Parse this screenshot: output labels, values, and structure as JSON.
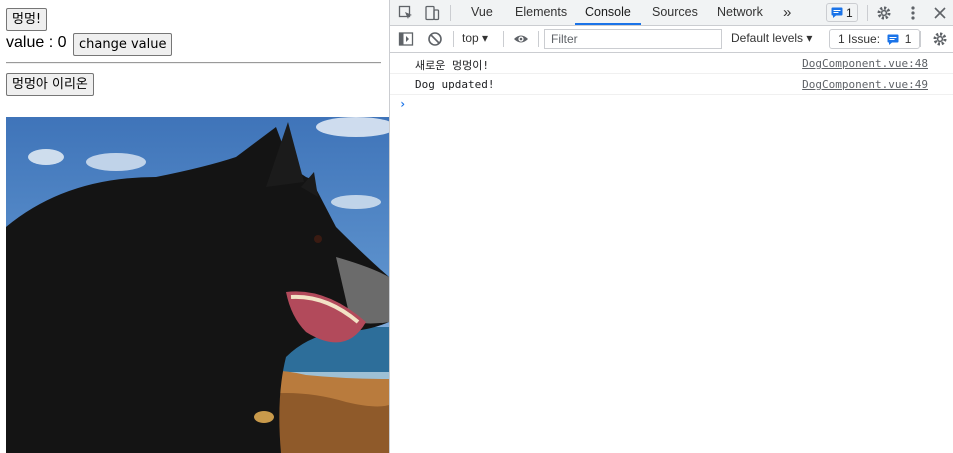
{
  "app": {
    "bark_button": "멍멍!",
    "value_prefix": "value : ",
    "value": "0",
    "change_button": "change value",
    "name_button": "멍멍아 이리온"
  },
  "devtools": {
    "tabs": [
      "Vue",
      "Elements",
      "Console",
      "Sources",
      "Network"
    ],
    "active_tab": "Console",
    "more_tabs_glyph": "»",
    "message_badge_count": "1",
    "toolbar": {
      "context": "top",
      "filter_placeholder": "Filter",
      "levels": "Default levels",
      "issues_label": "1 Issue:",
      "issues_count": "1"
    },
    "console": [
      {
        "message": "새로운 멍멍이!",
        "source": "DogComponent.vue:48"
      },
      {
        "message": "Dog updated!",
        "source": "DogComponent.vue:49"
      }
    ],
    "prompt_glyph": "›"
  },
  "colors": {
    "accent": "#1a73e8",
    "tabbar_bg": "#f1f3f4"
  }
}
